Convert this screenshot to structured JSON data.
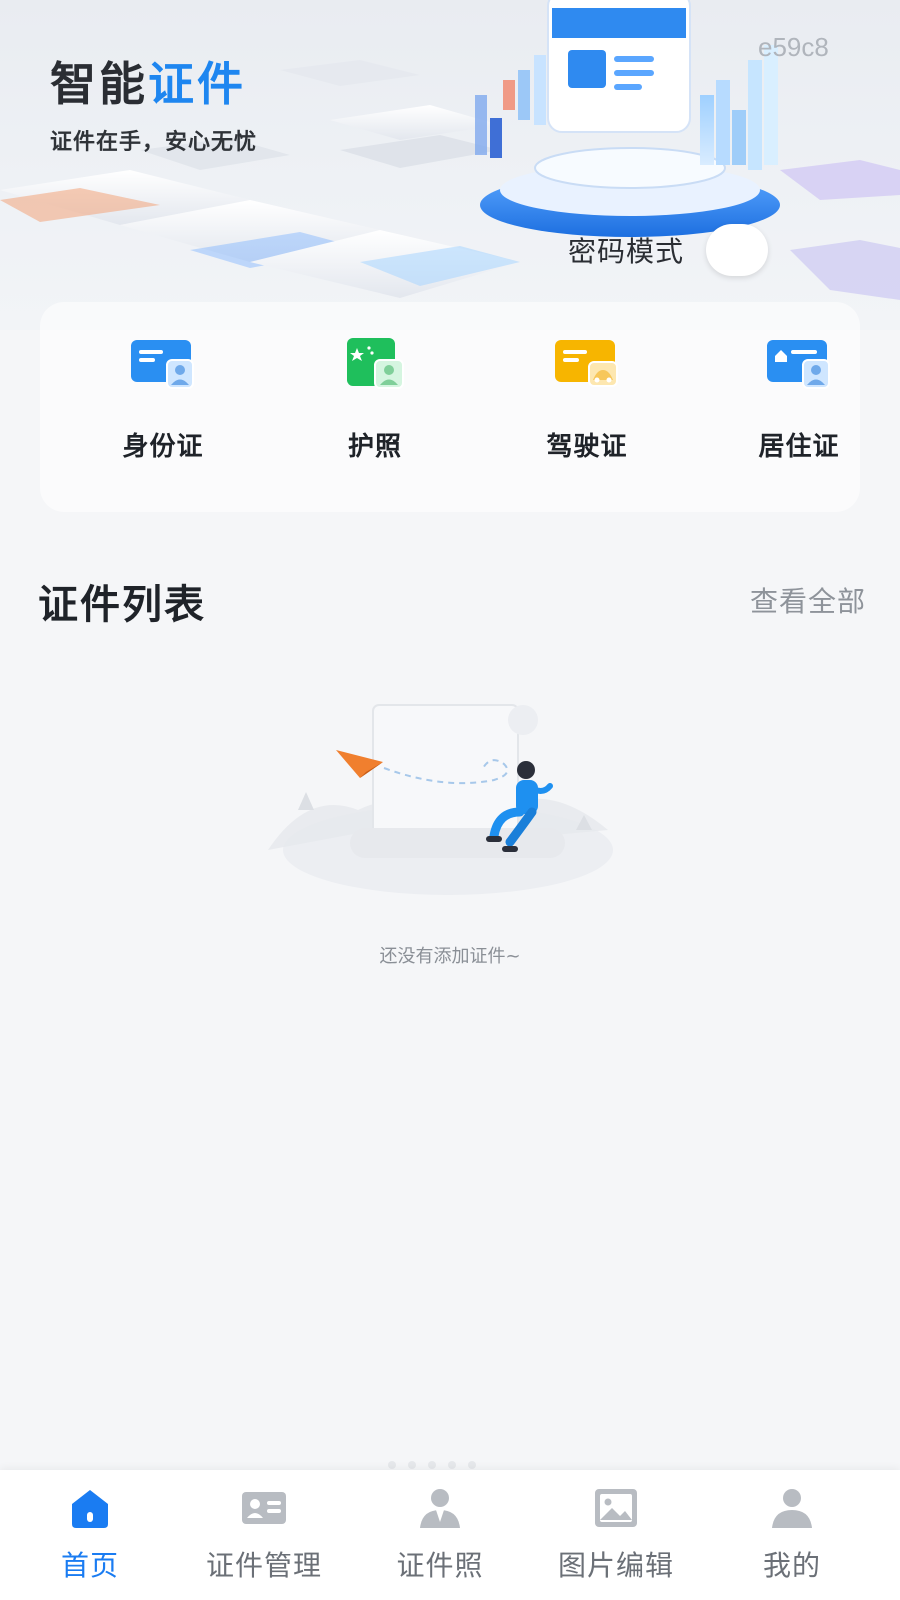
{
  "header": {
    "title_dark": "智能",
    "title_blue": "证件",
    "subtitle": "证件在手，安心无忧",
    "code": "e59c8",
    "password_mode_label": "密码模式"
  },
  "quick_items": [
    {
      "label": "身份证",
      "icon": "id-card-icon",
      "color": "#2a8ff2"
    },
    {
      "label": "护照",
      "icon": "passport-icon",
      "color": "#1fbf5c"
    },
    {
      "label": "驾驶证",
      "icon": "driver-license-icon",
      "color": "#f7b500"
    },
    {
      "label": "居住证",
      "icon": "residence-permit-icon",
      "color": "#2a8ff2"
    }
  ],
  "list_section": {
    "title": "证件列表",
    "view_all": "查看全部",
    "empty_text": "还没有添加证件~"
  },
  "tabbar": {
    "active_color": "#1a7cf2",
    "inactive_color": "#b8bcc2",
    "tabs": [
      {
        "label": "首页",
        "icon": "home-icon",
        "active": true
      },
      {
        "label": "证件管理",
        "icon": "id-manage-icon",
        "active": false
      },
      {
        "label": "证件照",
        "icon": "id-photo-icon",
        "active": false
      },
      {
        "label": "图片编辑",
        "icon": "image-edit-icon",
        "active": false
      },
      {
        "label": "我的",
        "icon": "user-icon",
        "active": false
      }
    ]
  }
}
